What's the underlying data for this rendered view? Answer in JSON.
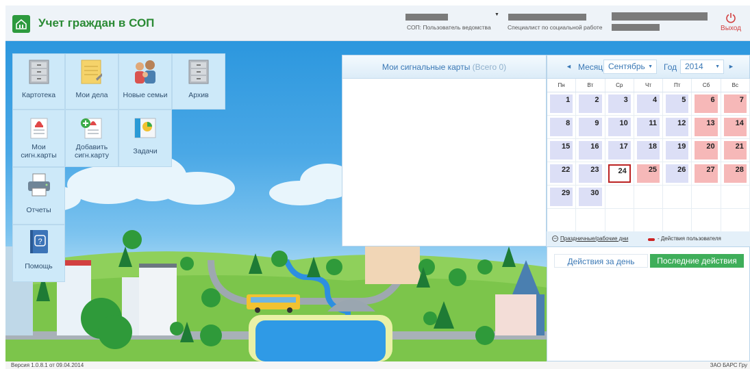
{
  "header": {
    "app_title": "Учет граждан в СОП",
    "role_label": "СОП: Пользователь ведомства",
    "position_label": "Специалист по социальной работе",
    "exit_label": "Выход"
  },
  "tiles": [
    {
      "label": "Картотека",
      "icon": "file-cabinet-icon"
    },
    {
      "label": "Мои дела",
      "icon": "notepad-icon"
    },
    {
      "label": "Новые семьи",
      "icon": "family-icon"
    },
    {
      "label": "Архив",
      "icon": "archive-cabinet-icon"
    },
    {
      "label1": "Мои",
      "label2": "сигн.карты",
      "icon": "alarm-card-icon"
    },
    {
      "label1": "Добавить",
      "label2": "сигн.карту",
      "icon": "add-card-icon"
    },
    {
      "label": "Задачи",
      "icon": "tasks-icon"
    },
    {
      "label": "Отчеты",
      "icon": "printer-icon"
    },
    {
      "label": "Помощь",
      "icon": "help-book-icon"
    }
  ],
  "cards_panel": {
    "title": "Мои сигнальные карты",
    "count": "(Всего 0)"
  },
  "calendar": {
    "month_label": "Месяц",
    "month_value": "Сентябрь",
    "year_label": "Год",
    "year_value": "2014",
    "weekdays": [
      "Пн",
      "Вт",
      "Ср",
      "Чт",
      "Пт",
      "Сб",
      "Вс"
    ],
    "days": [
      "1",
      "2",
      "3",
      "4",
      "5",
      "6",
      "7",
      "8",
      "9",
      "10",
      "11",
      "12",
      "13",
      "14",
      "15",
      "16",
      "17",
      "18",
      "19",
      "20",
      "21",
      "22",
      "23",
      "24",
      "25",
      "26",
      "27",
      "28",
      "29",
      "30"
    ],
    "holidays": [
      "6",
      "7",
      "13",
      "14",
      "20",
      "21",
      "25",
      "27",
      "28"
    ],
    "today": "24",
    "legend_holidays": "Праздничные/рабочие дни",
    "legend_actions": "- Действия пользователя"
  },
  "actions": {
    "tab_day": "Действия за день",
    "tab_last": "Последние действия"
  },
  "footer": {
    "version": "Версия 1.0.8.1 от 09.04.2014",
    "company": "ЗАО БАРС Гру"
  },
  "colors": {
    "brand_green": "#2d9a3e",
    "accent_blue": "#3a78b5",
    "holiday": "#f6b8b8",
    "workday": "#dcdff6"
  }
}
